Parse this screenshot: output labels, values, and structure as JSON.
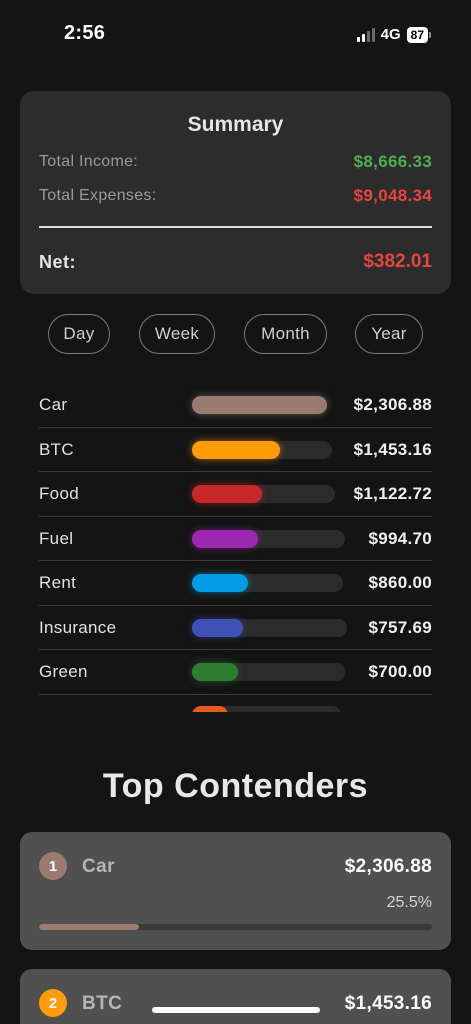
{
  "status_bar": {
    "time": "2:56",
    "network": "4G",
    "battery": "87"
  },
  "summary": {
    "title": "Summary",
    "income_label": "Total Income:",
    "income_value": "$8,666.33",
    "expenses_label": "Total Expenses:",
    "expenses_value": "$9,048.34",
    "net_label": "Net:",
    "net_value": "$382.01"
  },
  "periods": [
    "Day",
    "Week",
    "Month",
    "Year"
  ],
  "categories": [
    {
      "name": "Car",
      "amount": "$2,306.88",
      "fraction": 1.0,
      "color": "#9a7b6f"
    },
    {
      "name": "BTC",
      "amount": "$1,453.16",
      "fraction": 0.63,
      "color": "#ff9c0a"
    },
    {
      "name": "Food",
      "amount": "$1,122.72",
      "fraction": 0.49,
      "color": "#c62828"
    },
    {
      "name": "Fuel",
      "amount": "$994.70",
      "fraction": 0.43,
      "color": "#9c27b0"
    },
    {
      "name": "Rent",
      "amount": "$860.00",
      "fraction": 0.37,
      "color": "#039be5"
    },
    {
      "name": "Insurance",
      "amount": "$757.69",
      "fraction": 0.33,
      "color": "#3f51b5"
    },
    {
      "name": "Green",
      "amount": "$700.00",
      "fraction": 0.3,
      "color": "#2e7d32"
    }
  ],
  "top_contenders": {
    "title": "Top Contenders",
    "items": [
      {
        "rank": "1",
        "name": "Car",
        "amount": "$2,306.88",
        "percent": "25.5%",
        "fraction": 0.255,
        "color": "#9a7b6f"
      },
      {
        "rank": "2",
        "name": "BTC",
        "amount": "$1,453.16",
        "color": "#ff9c0a"
      }
    ]
  }
}
